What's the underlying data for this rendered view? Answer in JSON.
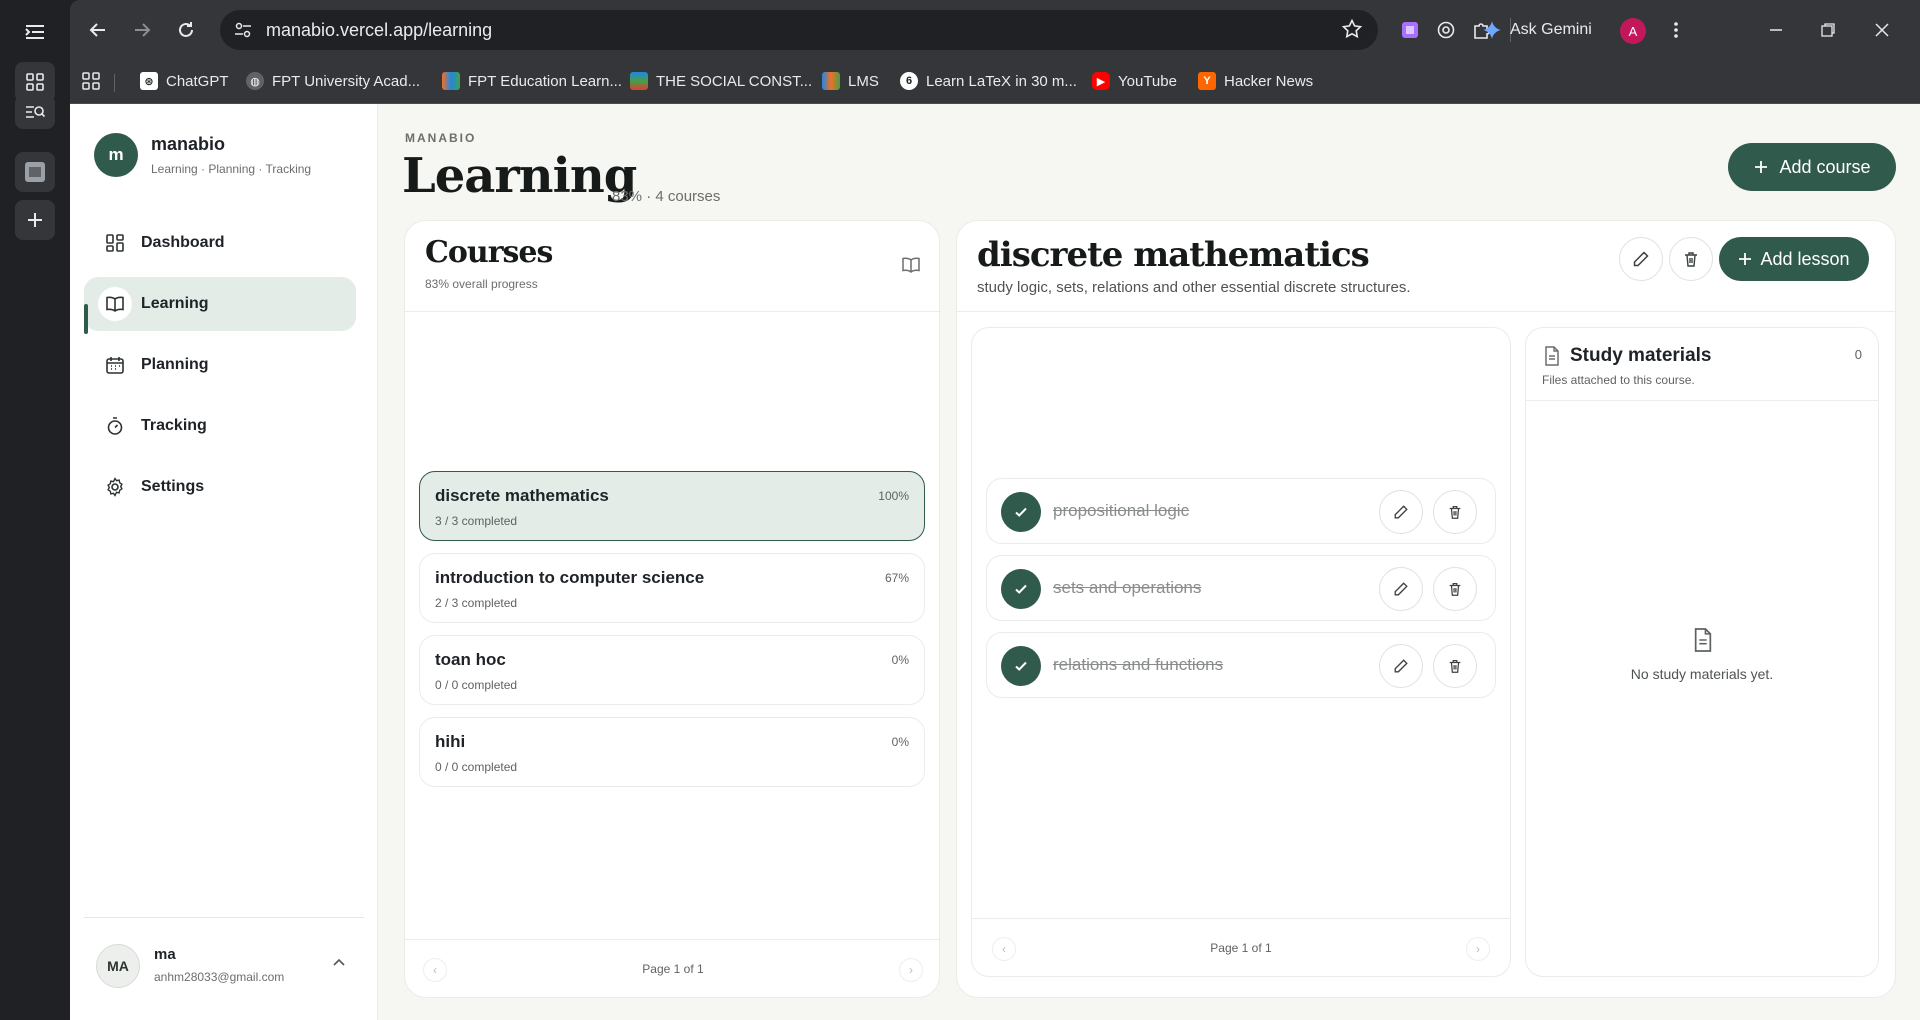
{
  "browser": {
    "url": "manabio.vercel.app/learning",
    "ask_gemini": "Ask Gemini",
    "profile_initial": "A",
    "bookmarks": [
      {
        "label": "ChatGPT",
        "icon": "chatgpt-icon",
        "color": "#202124"
      },
      {
        "label": "FPT University Acad...",
        "icon": "globe-icon",
        "color": "#5f6368"
      },
      {
        "label": "FPT Education Learn...",
        "icon": "fpt-icon",
        "color": "#f37021"
      },
      {
        "label": "THE SOCIAL CONST...",
        "icon": "stack-icon",
        "color": "#2e7d32"
      },
      {
        "label": "LMS",
        "icon": "fpt-icon",
        "color": "#1e88e5"
      },
      {
        "label": "Learn LaTeX in 30 m...",
        "icon": "overleaf-icon",
        "color": "#ffffff"
      },
      {
        "label": "YouTube",
        "icon": "youtube-icon",
        "color": "#ff0000"
      },
      {
        "label": "Hacker News",
        "icon": "hackernews-icon",
        "color": "#ff6600"
      }
    ]
  },
  "sidebar": {
    "brand_initial": "m",
    "brand_name": "manabio",
    "brand_tagline": "Learning · Planning · Tracking",
    "nav": [
      {
        "label": "Dashboard",
        "icon": "grid-icon",
        "active": false
      },
      {
        "label": "Learning",
        "icon": "book-icon",
        "active": true
      },
      {
        "label": "Planning",
        "icon": "calendar-icon",
        "active": false
      },
      {
        "label": "Tracking",
        "icon": "timer-icon",
        "active": false
      },
      {
        "label": "Settings",
        "icon": "gear-icon",
        "active": false
      }
    ],
    "user": {
      "initials": "MA",
      "name": "ma",
      "email": "anhm28033@gmail.com"
    }
  },
  "header": {
    "eyebrow": "MANABIO",
    "title": "Learning",
    "meta": "83% · 4 courses",
    "add_course": "Add course"
  },
  "courses": {
    "title": "Courses",
    "subtitle": "83% overall progress",
    "items": [
      {
        "name": "discrete mathematics",
        "progress": "3 / 3 completed",
        "pct": "100%",
        "selected": true
      },
      {
        "name": "introduction to computer science",
        "progress": "2 / 3 completed",
        "pct": "67%",
        "selected": false
      },
      {
        "name": "toan hoc",
        "progress": "0 / 0 completed",
        "pct": "0%",
        "selected": false
      },
      {
        "name": "hihi",
        "progress": "0 / 0 completed",
        "pct": "0%",
        "selected": false
      }
    ],
    "pagination": "Page 1 of 1"
  },
  "detail": {
    "title": "discrete mathematics",
    "description": "study logic, sets, relations and other essential discrete structures.",
    "add_lesson": "Add lesson",
    "lessons": [
      {
        "name": "propositional logic",
        "done": true
      },
      {
        "name": "sets and operations",
        "done": true
      },
      {
        "name": "relations and functions",
        "done": true
      }
    ],
    "pagination": "Page 1 of 1",
    "materials": {
      "title": "Study materials",
      "subtitle": "Files attached to this course.",
      "count": "0",
      "empty": "No study materials yet."
    }
  },
  "colors": {
    "accent": "#2f5a4c",
    "selected_bg": "#e4ece7",
    "page_bg": "#f6f6f3"
  }
}
